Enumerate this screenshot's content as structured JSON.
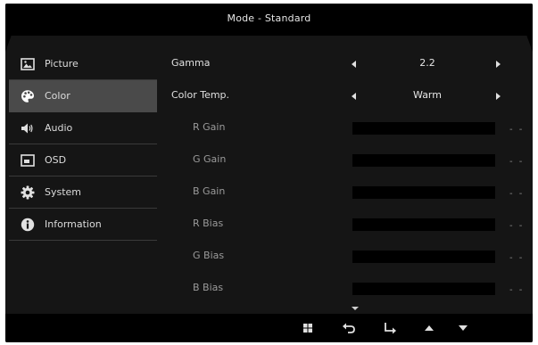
{
  "window": {
    "title": "Mode - Standard"
  },
  "sidebar": {
    "items": [
      {
        "label": "Picture",
        "icon": "picture-icon",
        "active": false
      },
      {
        "label": "Color",
        "icon": "palette-icon",
        "active": true
      },
      {
        "label": "Audio",
        "icon": "speaker-icon",
        "active": false
      },
      {
        "label": "OSD",
        "icon": "osd-window-icon",
        "active": false
      },
      {
        "label": "System",
        "icon": "gear-icon",
        "active": false
      },
      {
        "label": "Information",
        "icon": "info-icon",
        "active": false
      }
    ]
  },
  "settings": {
    "gamma": {
      "label": "Gamma",
      "value": "2.2"
    },
    "color_temp": {
      "label": "Color Temp.",
      "value": "Warm"
    },
    "r_gain": {
      "label": "R Gain",
      "value": "- -"
    },
    "g_gain": {
      "label": "G Gain",
      "value": "- -"
    },
    "b_gain": {
      "label": "B Gain",
      "value": "- -"
    },
    "r_bias": {
      "label": "R Bias",
      "value": "- -"
    },
    "g_bias": {
      "label": "G Bias",
      "value": "- -"
    },
    "b_bias": {
      "label": "B Bias",
      "value": "- -"
    }
  },
  "bottom_bar": {
    "buttons": [
      "menu-grid-icon",
      "back-icon",
      "enter-icon",
      "up-arrow-icon",
      "down-arrow-icon"
    ]
  },
  "colors": {
    "background": "#151515",
    "bar": "#000000",
    "active_item": "#4a4a4a",
    "text": "#e0e0e0",
    "dim_text": "#9a9a9a"
  }
}
